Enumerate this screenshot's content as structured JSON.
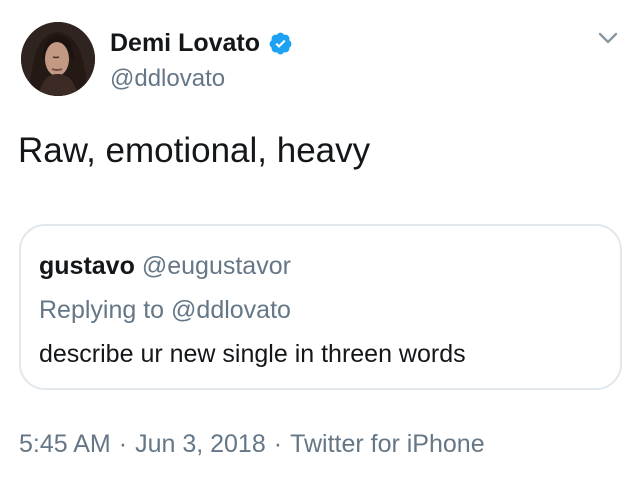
{
  "author": {
    "display_name": "Demi Lovato",
    "handle": "@ddlovato",
    "verified": true
  },
  "tweet": {
    "text": "Raw, emotional, heavy"
  },
  "quote": {
    "display_name": "gustavo",
    "handle": "@eugustavor",
    "replying_prefix": "Replying to",
    "replying_handle": "@ddlovato",
    "text": "describe ur new single in threen words"
  },
  "meta": {
    "time": "5:45 AM",
    "date": "Jun 3, 2018",
    "source": "Twitter for iPhone",
    "separator": "·"
  },
  "icons": {
    "verified": "verified-badge-icon",
    "menu": "chevron-down-icon"
  },
  "colors": {
    "text_primary": "#14171a",
    "text_secondary": "#657786",
    "verified_blue": "#1da1f2",
    "border": "#e1e8ed"
  }
}
